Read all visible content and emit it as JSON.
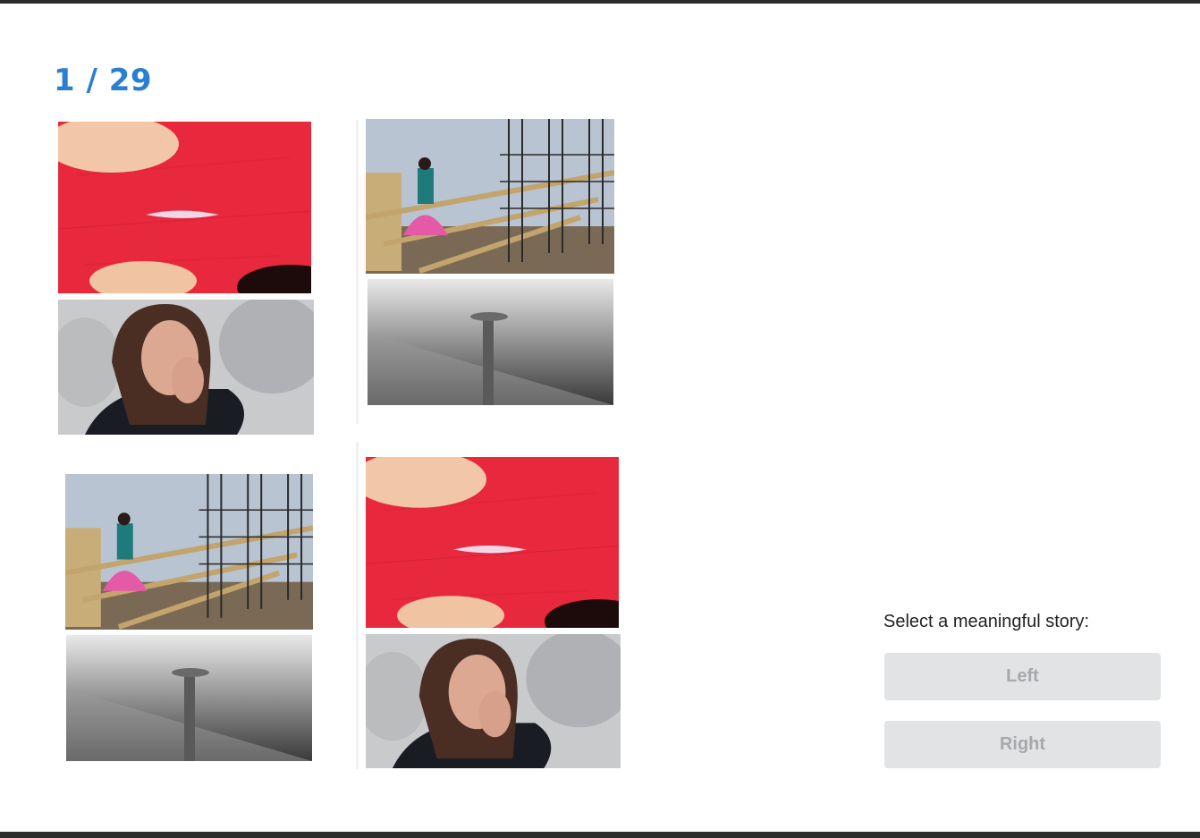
{
  "progress": {
    "current": "1",
    "separator": " / ",
    "total": "29"
  },
  "options": {
    "left": [
      "torn-fabric-photo",
      "crying-woman-photo"
    ],
    "right": [
      "construction-dancer-photo",
      "nail-photo"
    ],
    "left_bottom": [
      "construction-dancer-photo",
      "nail-photo"
    ],
    "right_bottom": [
      "torn-fabric-photo",
      "crying-woman-photo"
    ]
  },
  "question": {
    "prompt": "Select a meaningful story:"
  },
  "buttons": {
    "left_label": "Left",
    "right_label": "Right"
  },
  "colors": {
    "accent": "#2b7fd0",
    "button_bg": "#e2e3e5",
    "button_text": "#a6a8ab"
  }
}
